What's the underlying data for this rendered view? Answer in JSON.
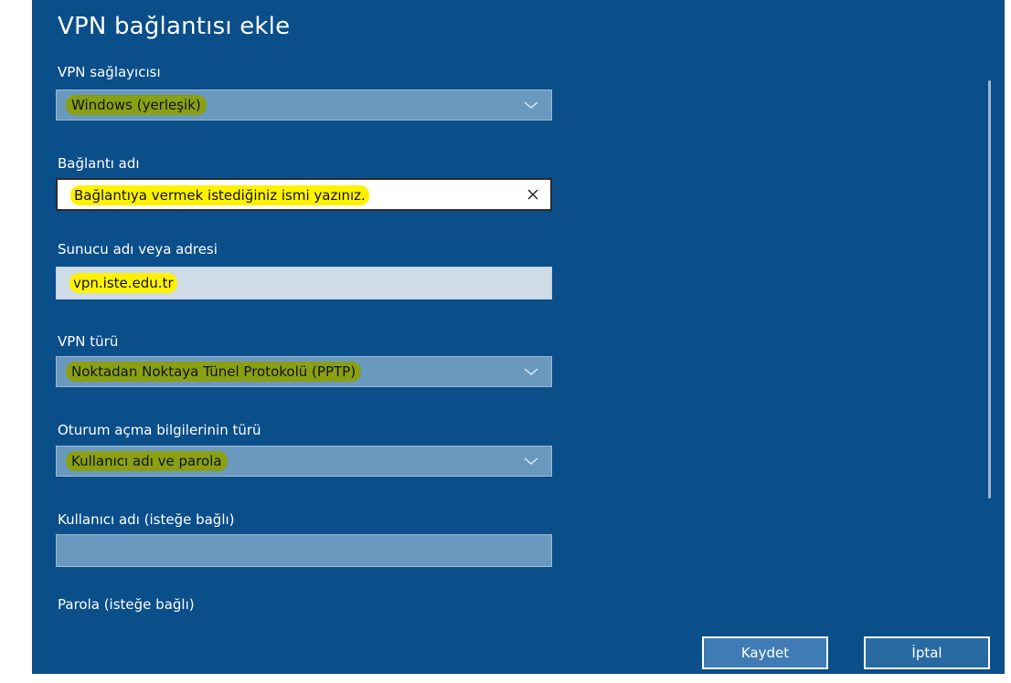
{
  "dialog": {
    "title": "VPN bağlantısı ekle",
    "fields": {
      "provider": {
        "label": "VPN sağlayıcısı",
        "value": "Windows (yerleşik)"
      },
      "connection_name": {
        "label": "Bağlantı adı",
        "value": "Bağlantıya vermek istediğiniz ismi yazınız."
      },
      "server": {
        "label": "Sunucu adı veya adresi",
        "value": "vpn.iste.edu.tr"
      },
      "vpn_type": {
        "label": "VPN türü",
        "value": "Noktadan Noktaya Tünel Protokolü (PPTP)"
      },
      "signin_type": {
        "label": "Oturum açma bilgilerinin türü",
        "value": "Kullanıcı adı ve parola"
      },
      "username": {
        "label": "Kullanıcı adı (isteğe bağlı)",
        "value": ""
      },
      "password": {
        "label": "Parola (isteğe bağlı)"
      }
    },
    "buttons": {
      "save": "Kaydet",
      "cancel": "İptal"
    },
    "colors": {
      "background": "#0a4e8a",
      "green_highlight": "#8aa012",
      "yellow_highlight": "#fff200"
    },
    "icons": {
      "dropdown": "chevron-down-icon",
      "clear": "close-icon"
    }
  }
}
